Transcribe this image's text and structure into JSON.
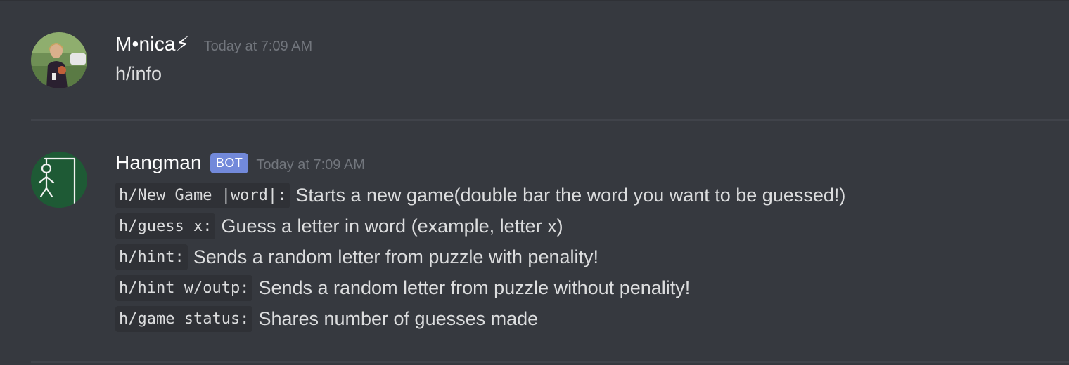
{
  "messages": [
    {
      "author": "M•nica⚡",
      "timestamp": "Today at 7:09 AM",
      "text": "h/info",
      "avatar_icon": "user-photo-avatar"
    },
    {
      "author": "Hangman",
      "badge": "BOT",
      "timestamp": "Today at 7:09 AM",
      "avatar_icon": "hangman-stick-figure-avatar",
      "lines": [
        {
          "code": "h/New Game |word|:",
          "text": "Starts a new game(double bar the word you want to be guessed!)"
        },
        {
          "code": "h/guess x:",
          "text": "Guess a letter in word (example, letter x)"
        },
        {
          "code": "h/hint:",
          "text": "Sends a random letter from puzzle with penality!"
        },
        {
          "code": "h/hint w/outp:",
          "text": "Sends a random letter from puzzle without penality!"
        },
        {
          "code": "h/game status:",
          "text": "Shares number of guesses made"
        }
      ]
    }
  ],
  "colors": {
    "background": "#36393f",
    "username": "#ffffff",
    "timestamp": "#72767d",
    "text": "#dcddde",
    "bot_badge": "#7289da",
    "code_bg": "#2f3136"
  }
}
